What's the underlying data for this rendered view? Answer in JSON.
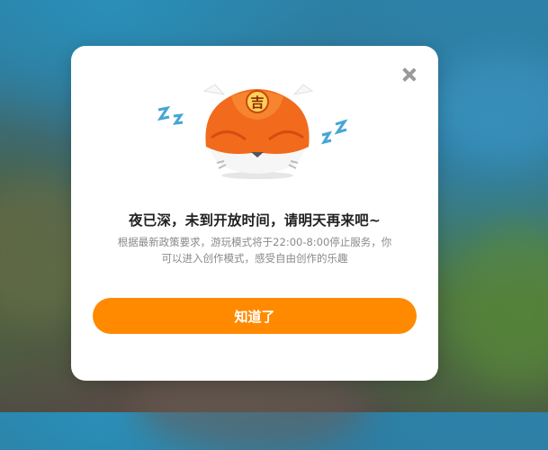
{
  "dialog": {
    "title": "夜已深，未到开放时间，请明天再来吧~",
    "desc_line1": "根据最新政策要求，游玩模式将于22:00-8:00停止服务，你",
    "desc_line2": "可以进入创作模式，感受自由创作的乐趣",
    "ok_label": "知道了",
    "close_icon": "close-icon",
    "mascot_icon": "sleeping-tiger-mascot",
    "mascot_badge_text": "吉",
    "sleep_text_left": "z z",
    "sleep_text_right": "z z"
  },
  "colors": {
    "accent": "#ff8a00",
    "title": "#222222",
    "desc": "#8a8a8a",
    "sleep_z": "#45a6d6",
    "mascot_orange": "#f26a1b"
  }
}
